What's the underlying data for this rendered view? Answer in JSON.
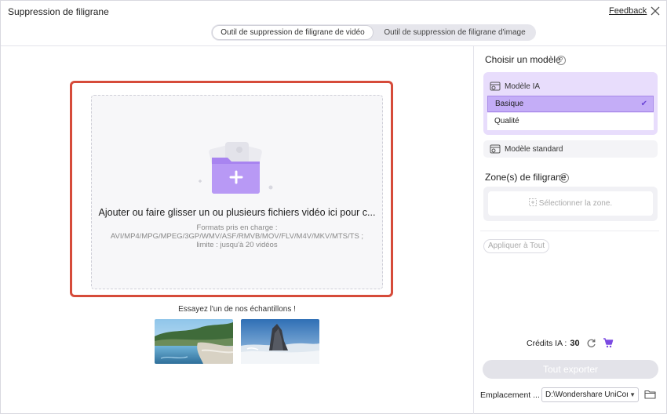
{
  "window": {
    "title": "Suppression de filigrane",
    "feedback_label": "Feedback"
  },
  "tabs": [
    {
      "label": "Outil de suppression de filigrane de vidéo",
      "active": true
    },
    {
      "label": "Outil de suppression de filigrane d'image",
      "active": false
    }
  ],
  "dropzone": {
    "main_text": "Ajouter ou faire glisser un ou plusieurs fichiers vidéo ici pour c...",
    "formats_line1": "Formats pris en charge :",
    "formats_line2": "AVI/MP4/MPG/MPEG/3GP/WMV/ASF/RMVB/MOV/FLV/M4V/MKV/MTS/TS ;",
    "formats_line3": "limite : jusqu'à 20 vidéos"
  },
  "samples": {
    "label": "Essayez l'un de nos échantillons !"
  },
  "model": {
    "title": "Choisir un modèle",
    "ai_label": "Modèle IA",
    "options": [
      {
        "label": "Basique",
        "selected": true
      },
      {
        "label": "Qualité",
        "selected": false
      }
    ],
    "standard_label": "Modèle standard"
  },
  "zones": {
    "title": "Zone(s) de filigrane",
    "select_label": "Sélectionner la zone.",
    "apply_all_label": "Appliquer à Tout"
  },
  "footer": {
    "credits_label": "Crédits IA :",
    "credits_value": "30",
    "export_label": "Tout exporter",
    "location_label": "Emplacement ...",
    "location_value": "D:\\Wondershare UniCor"
  },
  "colors": {
    "accent": "#8b5cf6",
    "outline": "#d64b3a",
    "model_card": "#e8ddfc",
    "selected_option": "#c4adf7"
  }
}
